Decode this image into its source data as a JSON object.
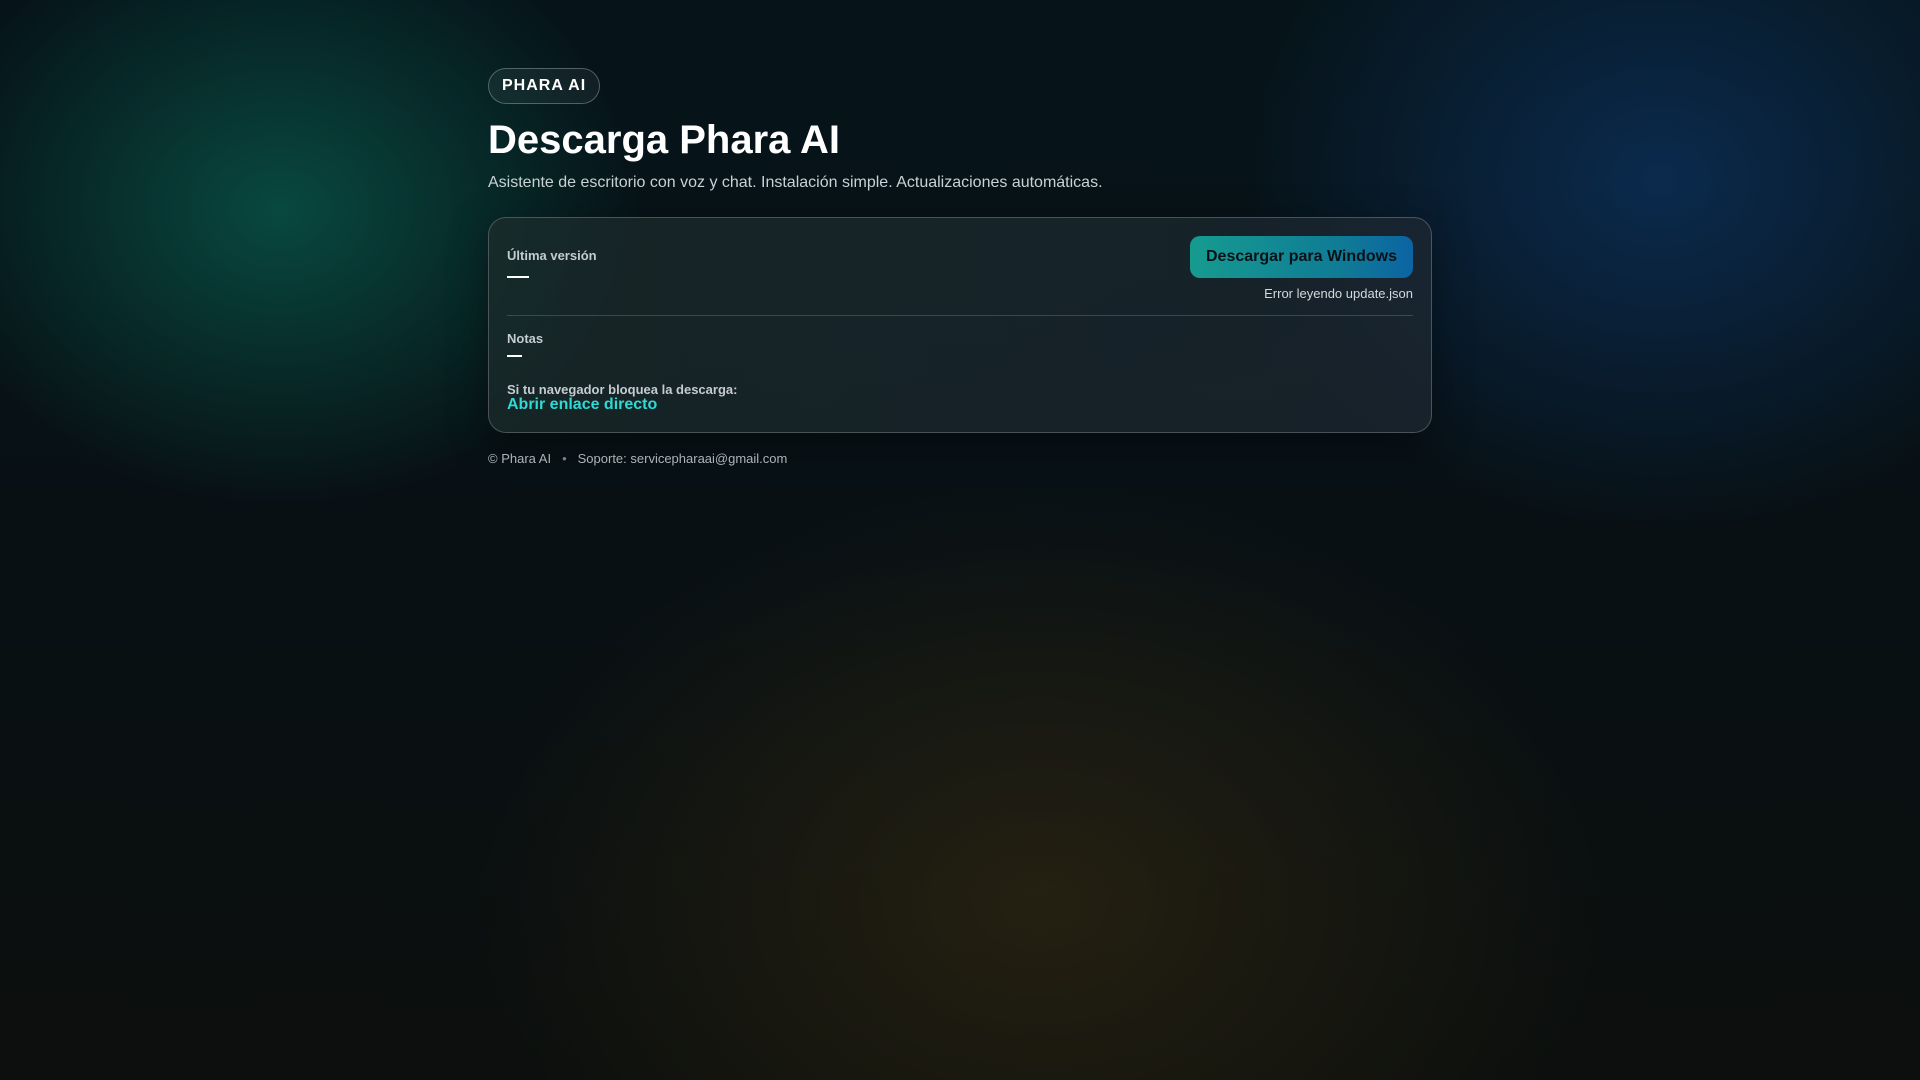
{
  "brand": {
    "pill_label": "PHARA AI"
  },
  "header": {
    "title": "Descarga Phara AI",
    "subtitle": "Asistente de escritorio con voz y chat. Instalación simple. Actualizaciones automáticas."
  },
  "card": {
    "version_label": "Última versión",
    "download_button_label": "Descargar para Windows",
    "status_text": "Error leyendo update.json",
    "notes_label": "Notas",
    "blocked_label": "Si tu navegador bloquea la descarga:",
    "direct_link_label": "Abrir enlace directo"
  },
  "footer": {
    "copyright": "© Phara AI",
    "separator": "•",
    "support": "Soporte: servicepharaai@gmail.com"
  },
  "colors": {
    "accent_link": "#2fd9d4",
    "button_gradient_start": "#169b90",
    "button_gradient_end": "#0c63a3"
  }
}
